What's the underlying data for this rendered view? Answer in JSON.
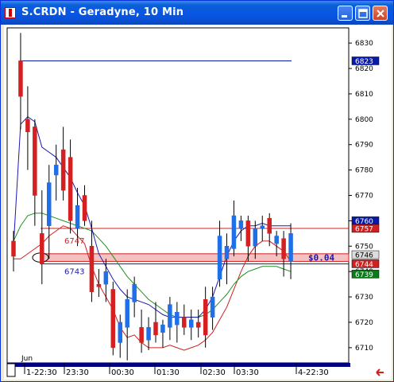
{
  "window": {
    "title": "S.CRDN - Geradyne, 10 Min",
    "controls": {
      "minimize": "minimize-icon",
      "maximize": "maximize-icon",
      "close": "close-icon"
    }
  },
  "chart_data": {
    "type": "candlestick",
    "title": "S.CRDN - Geradyne, 10 Min",
    "ylim": [
      6704,
      6836
    ],
    "y_ticks": [
      "6830",
      "6820",
      "6810",
      "6800",
      "6790",
      "6780",
      "6770",
      "6760",
      "6750",
      "6740",
      "6730",
      "6720",
      "6710"
    ],
    "x_ticks": [
      "1-22:30",
      "23:30",
      "00:30",
      "01:30",
      "02:30",
      "03:30",
      "4-22:30"
    ],
    "x_period_label": "Jun",
    "candles": [
      {
        "o": 6752,
        "h": 6756,
        "l": 6740,
        "c": 6746
      },
      {
        "o": 6823,
        "h": 6834,
        "l": 6796,
        "c": 6809
      },
      {
        "o": 6800,
        "h": 6813,
        "l": 6780,
        "c": 6795
      },
      {
        "o": 6797,
        "h": 6800,
        "l": 6758,
        "c": 6770
      },
      {
        "o": 6755,
        "h": 6772,
        "l": 6735,
        "c": 6743
      },
      {
        "o": 6758,
        "h": 6782,
        "l": 6745,
        "c": 6775
      },
      {
        "o": 6778,
        "h": 6790,
        "l": 6768,
        "c": 6782
      },
      {
        "o": 6788,
        "h": 6797,
        "l": 6768,
        "c": 6772
      },
      {
        "o": 6785,
        "h": 6792,
        "l": 6755,
        "c": 6760
      },
      {
        "o": 6757,
        "h": 6773,
        "l": 6750,
        "c": 6766
      },
      {
        "o": 6770,
        "h": 6774,
        "l": 6758,
        "c": 6760
      },
      {
        "o": 6750,
        "h": 6760,
        "l": 6728,
        "c": 6732
      },
      {
        "o": 6735,
        "h": 6741,
        "l": 6730,
        "c": 6734
      },
      {
        "o": 6735,
        "h": 6745,
        "l": 6728,
        "c": 6740
      },
      {
        "o": 6733,
        "h": 6736,
        "l": 6707,
        "c": 6710
      },
      {
        "o": 6712,
        "h": 6723,
        "l": 6706,
        "c": 6720
      },
      {
        "o": 6718,
        "h": 6733,
        "l": 6705,
        "c": 6729
      },
      {
        "o": 6728,
        "h": 6738,
        "l": 6722,
        "c": 6735
      },
      {
        "o": 6718,
        "h": 6725,
        "l": 6708,
        "c": 6712
      },
      {
        "o": 6713,
        "h": 6722,
        "l": 6709,
        "c": 6718
      },
      {
        "o": 6720,
        "h": 6728,
        "l": 6712,
        "c": 6715
      },
      {
        "o": 6716,
        "h": 6721,
        "l": 6710,
        "c": 6719
      },
      {
        "o": 6718,
        "h": 6730,
        "l": 6713,
        "c": 6727
      },
      {
        "o": 6719,
        "h": 6728,
        "l": 6712,
        "c": 6724
      },
      {
        "o": 6722,
        "h": 6727,
        "l": 6715,
        "c": 6718
      },
      {
        "o": 6718,
        "h": 6725,
        "l": 6713,
        "c": 6721
      },
      {
        "o": 6720,
        "h": 6725,
        "l": 6714,
        "c": 6718
      },
      {
        "o": 6729,
        "h": 6734,
        "l": 6710,
        "c": 6715
      },
      {
        "o": 6722,
        "h": 6734,
        "l": 6717,
        "c": 6730
      },
      {
        "o": 6737,
        "h": 6760,
        "l": 6734,
        "c": 6754
      },
      {
        "o": 6745,
        "h": 6755,
        "l": 6735,
        "c": 6750
      },
      {
        "o": 6749,
        "h": 6768,
        "l": 6746,
        "c": 6762
      },
      {
        "o": 6757,
        "h": 6762,
        "l": 6752,
        "c": 6760
      },
      {
        "o": 6760,
        "h": 6762,
        "l": 6744,
        "c": 6750
      },
      {
        "o": 6750,
        "h": 6760,
        "l": 6745,
        "c": 6757
      },
      {
        "o": 6757,
        "h": 6762,
        "l": 6752,
        "c": 6758
      },
      {
        "o": 6761,
        "h": 6763,
        "l": 6750,
        "c": 6755
      },
      {
        "o": 6751,
        "h": 6756,
        "l": 6746,
        "c": 6754
      },
      {
        "o": 6753,
        "h": 6756,
        "l": 6738,
        "c": 6745
      },
      {
        "o": 6744,
        "h": 6759,
        "l": 6737,
        "c": 6755
      }
    ],
    "ma_fast": [
      6750,
      6798,
      6801,
      6799,
      6789,
      6787,
      6785,
      6781,
      6777,
      6771,
      6766,
      6757,
      6747,
      6742,
      6737,
      6733,
      6730,
      6729,
      6728,
      6727,
      6725,
      6723,
      6722,
      6722,
      6722,
      6722,
      6722,
      6725,
      6730,
      6738,
      6746,
      6752,
      6756,
      6758,
      6758,
      6759,
      6758,
      6758,
      6758,
      6758
    ],
    "ma_slow": [
      6752,
      6758,
      6762,
      6763,
      6763,
      6762,
      6761,
      6760,
      6759,
      6758,
      6757,
      6756,
      6753,
      6750,
      6746,
      6742,
      6738,
      6735,
      6732,
      6729,
      6727,
      6725,
      6723,
      6722,
      6722,
      6722,
      6722,
      6723,
      6725,
      6728,
      6731,
      6735,
      6738,
      6740,
      6741,
      6742,
      6742,
      6742,
      6741,
      6740
    ],
    "bb_lower": [
      6745,
      6745,
      6747,
      6749,
      6751,
      6754,
      6756,
      6758,
      6757,
      6754,
      6751,
      6742,
      6735,
      6730,
      6725,
      6718,
      6714,
      6715,
      6712,
      6710,
      6710,
      6710,
      6711,
      6710,
      6709,
      6710,
      6711,
      6713,
      6716,
      6721,
      6726,
      6733,
      6740,
      6746,
      6750,
      6752,
      6752,
      6750,
      6748,
      6744
    ],
    "h_lines": [
      {
        "name": "resistance",
        "value": 6823,
        "color": "#0a1aa8"
      },
      {
        "name": "upper",
        "value": 6757,
        "color": "#d02020"
      },
      {
        "name": "lower",
        "value": 6743,
        "color": "#1a1aa8"
      }
    ],
    "shaded_band": {
      "from": 6744,
      "to": 6747,
      "color": "#f5c0c0",
      "label": "$0.04"
    },
    "band_labels": [
      {
        "text": "6747",
        "value": 6747,
        "color": "#d02020"
      },
      {
        "text": "6743",
        "value": 6743,
        "color": "#1a1aa8"
      }
    ],
    "price_tags": [
      {
        "text": "6823",
        "value": 6823,
        "bg": "#0a1aa8",
        "fg": "#ffffff"
      },
      {
        "text": "6760",
        "value": 6760,
        "bg": "#0a1aa8",
        "fg": "#ffffff"
      },
      {
        "text": "6757",
        "value": 6757,
        "bg": "#d02020",
        "fg": "#ffffff"
      },
      {
        "text": "6746",
        "value": 6746,
        "bg": "#dddddd",
        "fg": "#000000"
      },
      {
        "text": "6744",
        "value": 6744,
        "bg": "#d02020",
        "fg": "#ffffff"
      },
      {
        "text": "6739",
        "value": 6739,
        "bg": "#0a7a1a",
        "fg": "#ffffff"
      }
    ],
    "colors": {
      "up": "#1e6fe8",
      "down": "#d42020",
      "ma_fast": "#1a1ab0",
      "ma_slow": "#209020",
      "bb": "#d02020",
      "axis": "#000080"
    }
  }
}
